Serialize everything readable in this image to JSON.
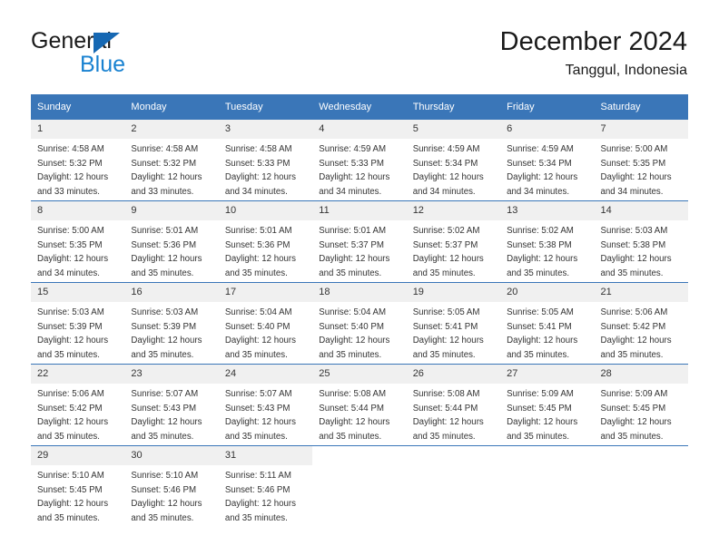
{
  "brand": {
    "name_part1": "General",
    "name_part2": "Blue",
    "triangle_color": "#1668b3",
    "blue_color": "#1982d1"
  },
  "header": {
    "title": "December 2024",
    "subtitle": "Tanggul, Indonesia"
  },
  "calendar": {
    "header_bg": "#3a76b8",
    "daynum_bg": "#f0f0f0",
    "weekdays": [
      "Sunday",
      "Monday",
      "Tuesday",
      "Wednesday",
      "Thursday",
      "Friday",
      "Saturday"
    ],
    "weeks": [
      [
        {
          "day": "1",
          "sunrise": "Sunrise: 4:58 AM",
          "sunset": "Sunset: 5:32 PM",
          "daylight1": "Daylight: 12 hours",
          "daylight2": "and 33 minutes."
        },
        {
          "day": "2",
          "sunrise": "Sunrise: 4:58 AM",
          "sunset": "Sunset: 5:32 PM",
          "daylight1": "Daylight: 12 hours",
          "daylight2": "and 33 minutes."
        },
        {
          "day": "3",
          "sunrise": "Sunrise: 4:58 AM",
          "sunset": "Sunset: 5:33 PM",
          "daylight1": "Daylight: 12 hours",
          "daylight2": "and 34 minutes."
        },
        {
          "day": "4",
          "sunrise": "Sunrise: 4:59 AM",
          "sunset": "Sunset: 5:33 PM",
          "daylight1": "Daylight: 12 hours",
          "daylight2": "and 34 minutes."
        },
        {
          "day": "5",
          "sunrise": "Sunrise: 4:59 AM",
          "sunset": "Sunset: 5:34 PM",
          "daylight1": "Daylight: 12 hours",
          "daylight2": "and 34 minutes."
        },
        {
          "day": "6",
          "sunrise": "Sunrise: 4:59 AM",
          "sunset": "Sunset: 5:34 PM",
          "daylight1": "Daylight: 12 hours",
          "daylight2": "and 34 minutes."
        },
        {
          "day": "7",
          "sunrise": "Sunrise: 5:00 AM",
          "sunset": "Sunset: 5:35 PM",
          "daylight1": "Daylight: 12 hours",
          "daylight2": "and 34 minutes."
        }
      ],
      [
        {
          "day": "8",
          "sunrise": "Sunrise: 5:00 AM",
          "sunset": "Sunset: 5:35 PM",
          "daylight1": "Daylight: 12 hours",
          "daylight2": "and 34 minutes."
        },
        {
          "day": "9",
          "sunrise": "Sunrise: 5:01 AM",
          "sunset": "Sunset: 5:36 PM",
          "daylight1": "Daylight: 12 hours",
          "daylight2": "and 35 minutes."
        },
        {
          "day": "10",
          "sunrise": "Sunrise: 5:01 AM",
          "sunset": "Sunset: 5:36 PM",
          "daylight1": "Daylight: 12 hours",
          "daylight2": "and 35 minutes."
        },
        {
          "day": "11",
          "sunrise": "Sunrise: 5:01 AM",
          "sunset": "Sunset: 5:37 PM",
          "daylight1": "Daylight: 12 hours",
          "daylight2": "and 35 minutes."
        },
        {
          "day": "12",
          "sunrise": "Sunrise: 5:02 AM",
          "sunset": "Sunset: 5:37 PM",
          "daylight1": "Daylight: 12 hours",
          "daylight2": "and 35 minutes."
        },
        {
          "day": "13",
          "sunrise": "Sunrise: 5:02 AM",
          "sunset": "Sunset: 5:38 PM",
          "daylight1": "Daylight: 12 hours",
          "daylight2": "and 35 minutes."
        },
        {
          "day": "14",
          "sunrise": "Sunrise: 5:03 AM",
          "sunset": "Sunset: 5:38 PM",
          "daylight1": "Daylight: 12 hours",
          "daylight2": "and 35 minutes."
        }
      ],
      [
        {
          "day": "15",
          "sunrise": "Sunrise: 5:03 AM",
          "sunset": "Sunset: 5:39 PM",
          "daylight1": "Daylight: 12 hours",
          "daylight2": "and 35 minutes."
        },
        {
          "day": "16",
          "sunrise": "Sunrise: 5:03 AM",
          "sunset": "Sunset: 5:39 PM",
          "daylight1": "Daylight: 12 hours",
          "daylight2": "and 35 minutes."
        },
        {
          "day": "17",
          "sunrise": "Sunrise: 5:04 AM",
          "sunset": "Sunset: 5:40 PM",
          "daylight1": "Daylight: 12 hours",
          "daylight2": "and 35 minutes."
        },
        {
          "day": "18",
          "sunrise": "Sunrise: 5:04 AM",
          "sunset": "Sunset: 5:40 PM",
          "daylight1": "Daylight: 12 hours",
          "daylight2": "and 35 minutes."
        },
        {
          "day": "19",
          "sunrise": "Sunrise: 5:05 AM",
          "sunset": "Sunset: 5:41 PM",
          "daylight1": "Daylight: 12 hours",
          "daylight2": "and 35 minutes."
        },
        {
          "day": "20",
          "sunrise": "Sunrise: 5:05 AM",
          "sunset": "Sunset: 5:41 PM",
          "daylight1": "Daylight: 12 hours",
          "daylight2": "and 35 minutes."
        },
        {
          "day": "21",
          "sunrise": "Sunrise: 5:06 AM",
          "sunset": "Sunset: 5:42 PM",
          "daylight1": "Daylight: 12 hours",
          "daylight2": "and 35 minutes."
        }
      ],
      [
        {
          "day": "22",
          "sunrise": "Sunrise: 5:06 AM",
          "sunset": "Sunset: 5:42 PM",
          "daylight1": "Daylight: 12 hours",
          "daylight2": "and 35 minutes."
        },
        {
          "day": "23",
          "sunrise": "Sunrise: 5:07 AM",
          "sunset": "Sunset: 5:43 PM",
          "daylight1": "Daylight: 12 hours",
          "daylight2": "and 35 minutes."
        },
        {
          "day": "24",
          "sunrise": "Sunrise: 5:07 AM",
          "sunset": "Sunset: 5:43 PM",
          "daylight1": "Daylight: 12 hours",
          "daylight2": "and 35 minutes."
        },
        {
          "day": "25",
          "sunrise": "Sunrise: 5:08 AM",
          "sunset": "Sunset: 5:44 PM",
          "daylight1": "Daylight: 12 hours",
          "daylight2": "and 35 minutes."
        },
        {
          "day": "26",
          "sunrise": "Sunrise: 5:08 AM",
          "sunset": "Sunset: 5:44 PM",
          "daylight1": "Daylight: 12 hours",
          "daylight2": "and 35 minutes."
        },
        {
          "day": "27",
          "sunrise": "Sunrise: 5:09 AM",
          "sunset": "Sunset: 5:45 PM",
          "daylight1": "Daylight: 12 hours",
          "daylight2": "and 35 minutes."
        },
        {
          "day": "28",
          "sunrise": "Sunrise: 5:09 AM",
          "sunset": "Sunset: 5:45 PM",
          "daylight1": "Daylight: 12 hours",
          "daylight2": "and 35 minutes."
        }
      ],
      [
        {
          "day": "29",
          "sunrise": "Sunrise: 5:10 AM",
          "sunset": "Sunset: 5:45 PM",
          "daylight1": "Daylight: 12 hours",
          "daylight2": "and 35 minutes."
        },
        {
          "day": "30",
          "sunrise": "Sunrise: 5:10 AM",
          "sunset": "Sunset: 5:46 PM",
          "daylight1": "Daylight: 12 hours",
          "daylight2": "and 35 minutes."
        },
        {
          "day": "31",
          "sunrise": "Sunrise: 5:11 AM",
          "sunset": "Sunset: 5:46 PM",
          "daylight1": "Daylight: 12 hours",
          "daylight2": "and 35 minutes."
        },
        {
          "day": "",
          "sunrise": "",
          "sunset": "",
          "daylight1": "",
          "daylight2": ""
        },
        {
          "day": "",
          "sunrise": "",
          "sunset": "",
          "daylight1": "",
          "daylight2": ""
        },
        {
          "day": "",
          "sunrise": "",
          "sunset": "",
          "daylight1": "",
          "daylight2": ""
        },
        {
          "day": "",
          "sunrise": "",
          "sunset": "",
          "daylight1": "",
          "daylight2": ""
        }
      ]
    ]
  }
}
